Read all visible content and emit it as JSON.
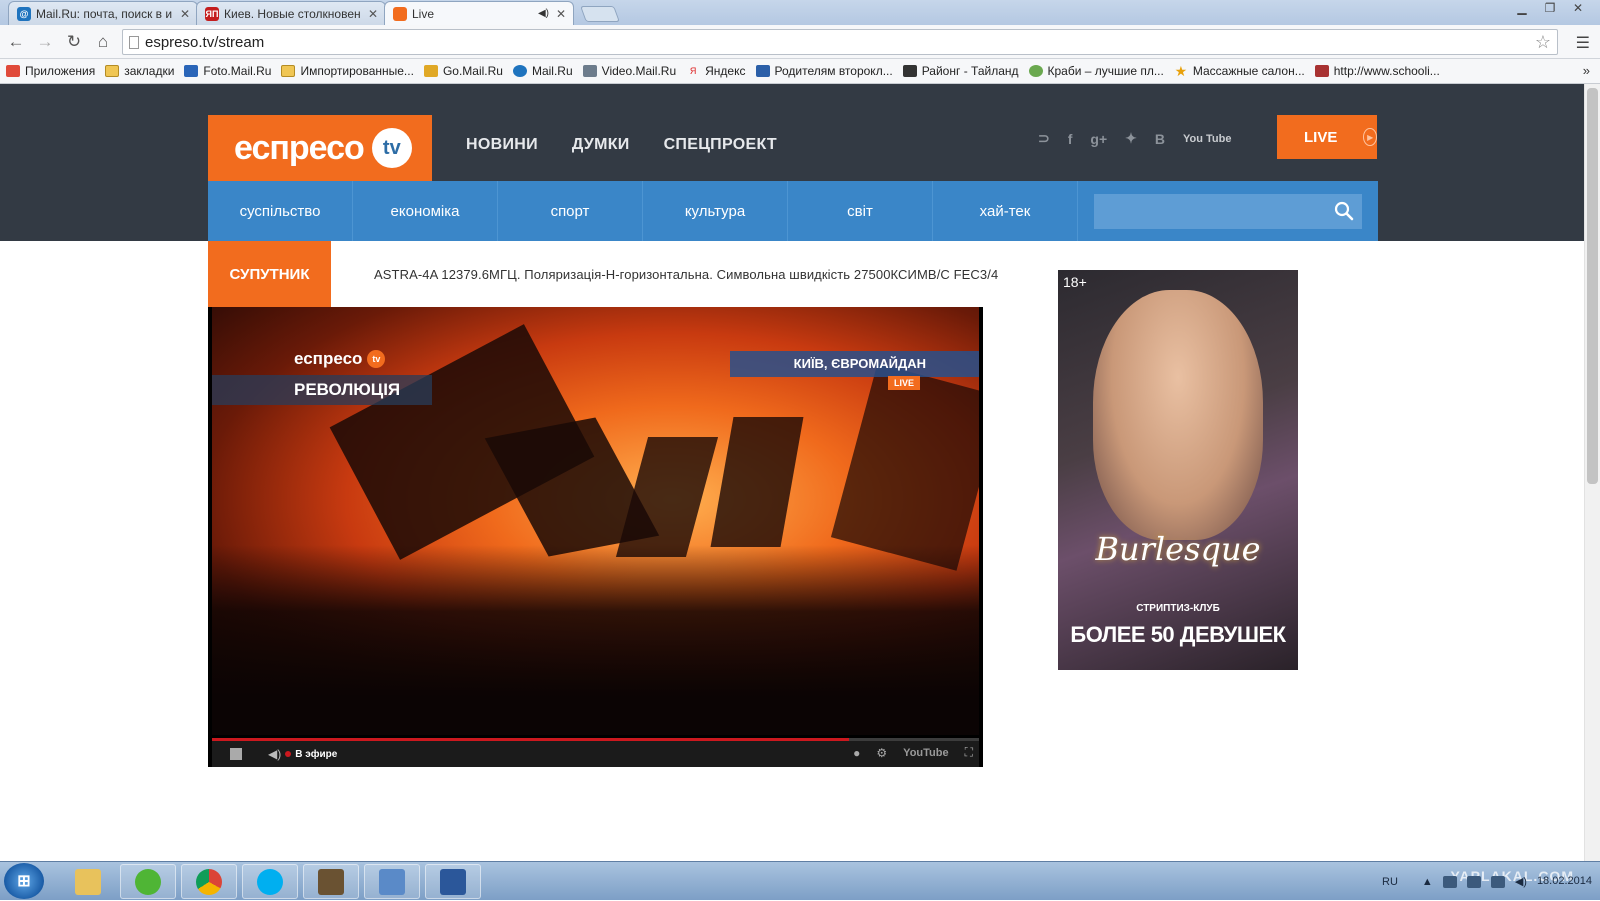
{
  "browser": {
    "tabs": [
      {
        "title": "Mail.Ru: почта, поиск в и",
        "icon": "mailru-icon"
      },
      {
        "title": "Киев. Новые столкновен",
        "icon": "yaplakal-icon",
        "fav_text": "ЯП"
      },
      {
        "title": "Live",
        "icon": "espreso-icon",
        "active": true
      }
    ],
    "url": "espreso.tv/stream",
    "bookmarks": [
      {
        "label": "Приложения",
        "icon": "apps-grid-icon"
      },
      {
        "label": "закладки",
        "icon": "folder-icon"
      },
      {
        "label": "Foto.Mail.Ru",
        "icon": "foto-mailru-icon"
      },
      {
        "label": "Импортированные...",
        "icon": "folder-icon"
      },
      {
        "label": "Go.Mail.Ru",
        "icon": "go-mailru-icon"
      },
      {
        "label": "Mail.Ru",
        "icon": "mailru-icon"
      },
      {
        "label": "Video.Mail.Ru",
        "icon": "video-mailru-icon"
      },
      {
        "label": "Яндекс",
        "icon": "yandex-icon",
        "fav_text": "Я"
      },
      {
        "label": "Родителям второкл...",
        "icon": "bookmark-icon"
      },
      {
        "label": "Районг - Тайланд",
        "icon": "bookmark-icon"
      },
      {
        "label": "Краби – лучшие пл...",
        "icon": "bookmark-icon"
      },
      {
        "label": "Массажные салон...",
        "icon": "star-bookmark-icon"
      },
      {
        "label": "http://www.schooli...",
        "icon": "bookmark-icon"
      }
    ],
    "bookmarks_more": "»"
  },
  "site": {
    "logo_word": "еспресо",
    "logo_tv": "tv",
    "main_nav": [
      "НОВИНИ",
      "ДУМКИ",
      "СПЕЦПРОЕКТ"
    ],
    "social": {
      "rss": "rss-icon",
      "facebook": "f",
      "gplus": "g+",
      "twitter": "twitter-icon",
      "vk": "В",
      "youtube": "You Tube"
    },
    "live_label": "LIVE",
    "categories": [
      "суспільство",
      "економіка",
      "спорт",
      "культура",
      "світ",
      "хай-тек"
    ],
    "search_placeholder": ""
  },
  "stream": {
    "sat_label": "СУПУТНИК",
    "sat_info": "ASTRA-4A 12379.6МГЦ. Поляризація-Н-горизонтальна. Символьна швидкість 27500КСИМВ/С FEC3/4",
    "video": {
      "logo_word": "еспресо",
      "logo_tv": "tv",
      "program": "РЕВОЛЮЦІЯ",
      "location": "КИЇВ, ЄВРОМАЙДАН",
      "live_badge": "LIVE"
    },
    "player": {
      "progress": 0.83,
      "status": "В эфире",
      "youtube_label": "YouTube"
    }
  },
  "ad": {
    "age": "18+",
    "brand": "Burlesque",
    "club": "СТРИПТИЗ-КЛУБ",
    "headline": "БОЛЕЕ 50 ДЕВУШЕК"
  },
  "taskbar": {
    "apps": [
      "icq-icon",
      "chrome-icon",
      "skype-icon",
      "game-icon",
      "photo-viewer-icon",
      "word-icon"
    ],
    "lang": "RU",
    "date": "18.02.2014",
    "watermark": "YAPLAKAL.COM"
  },
  "colors": {
    "accent": "#f26c1e",
    "nav_blue": "#3a86c8",
    "header_dark": "#333a44"
  }
}
